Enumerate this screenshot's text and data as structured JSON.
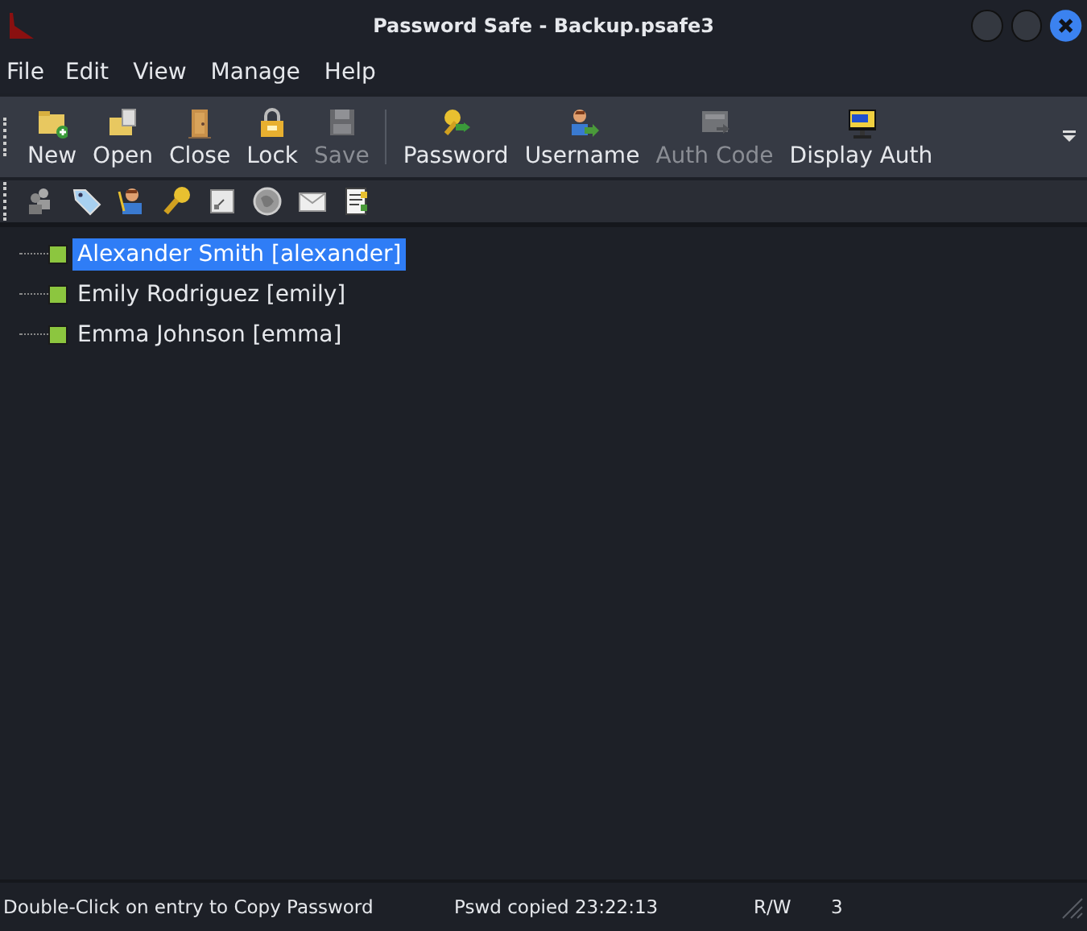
{
  "window": {
    "title": "Password Safe - Backup.psafe3"
  },
  "menu": [
    "File",
    "Edit",
    "View",
    "Manage",
    "Help"
  ],
  "toolbar": [
    {
      "label": "New",
      "disabled": false
    },
    {
      "label": "Open",
      "disabled": false
    },
    {
      "label": "Close",
      "disabled": false
    },
    {
      "label": "Lock",
      "disabled": false
    },
    {
      "label": "Save",
      "disabled": true
    },
    {
      "label": "Password",
      "disabled": false
    },
    {
      "label": "Username",
      "disabled": false
    },
    {
      "label": "Auth Code",
      "disabled": true
    },
    {
      "label": "Display Auth",
      "disabled": false
    }
  ],
  "tree": {
    "items": [
      {
        "label": "Alexander Smith [alexander]",
        "selected": true
      },
      {
        "label": "Emily Rodriguez [emily]",
        "selected": false
      },
      {
        "label": "Emma Johnson [emma]",
        "selected": false
      }
    ]
  },
  "status_bar": {
    "hint": "Double-Click on entry to Copy Password",
    "message": "Pswd copied 23:22:13",
    "mode": "R/W",
    "count": "3"
  }
}
